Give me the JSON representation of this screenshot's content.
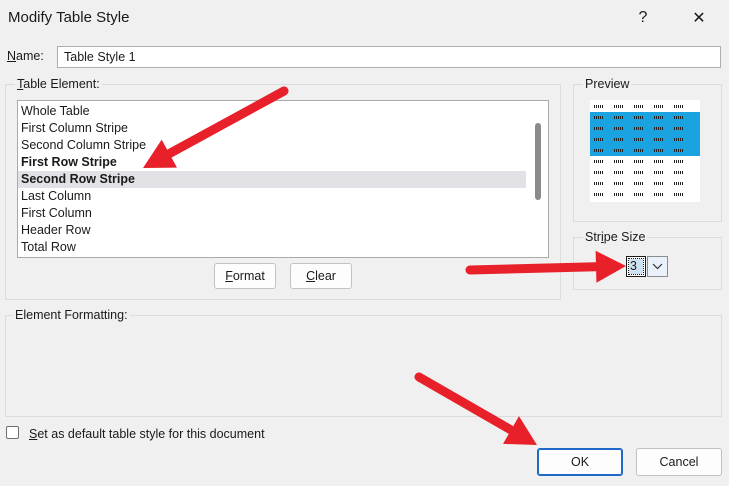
{
  "window": {
    "title": "Modify Table Style",
    "help_glyph": "?",
    "close_glyph": "✕"
  },
  "name": {
    "label": "Name:",
    "value": "Table Style 1"
  },
  "table_element": {
    "label": "Table Element:",
    "items": [
      {
        "label": "Whole Table",
        "bold": false,
        "selected": false
      },
      {
        "label": "First Column Stripe",
        "bold": false,
        "selected": false
      },
      {
        "label": "Second Column Stripe",
        "bold": false,
        "selected": false
      },
      {
        "label": "First Row Stripe",
        "bold": true,
        "selected": false
      },
      {
        "label": "Second Row Stripe",
        "bold": true,
        "selected": true
      },
      {
        "label": "Last Column",
        "bold": false,
        "selected": false
      },
      {
        "label": "First Column",
        "bold": false,
        "selected": false
      },
      {
        "label": "Header Row",
        "bold": false,
        "selected": false
      },
      {
        "label": "Total Row",
        "bold": false,
        "selected": false
      }
    ],
    "format_button": "Format",
    "clear_button": "Clear"
  },
  "preview": {
    "label": "Preview",
    "accent_color": "#1aa3e0"
  },
  "stripe_size": {
    "label": "Stripe Size",
    "value": "3"
  },
  "element_formatting": {
    "label": "Element Formatting:"
  },
  "default_checkbox": {
    "label": "Set as default table style for this document",
    "checked": false
  },
  "buttons": {
    "ok": "OK",
    "cancel": "Cancel"
  },
  "annotation": {
    "arrow_color": "#e8202a"
  }
}
